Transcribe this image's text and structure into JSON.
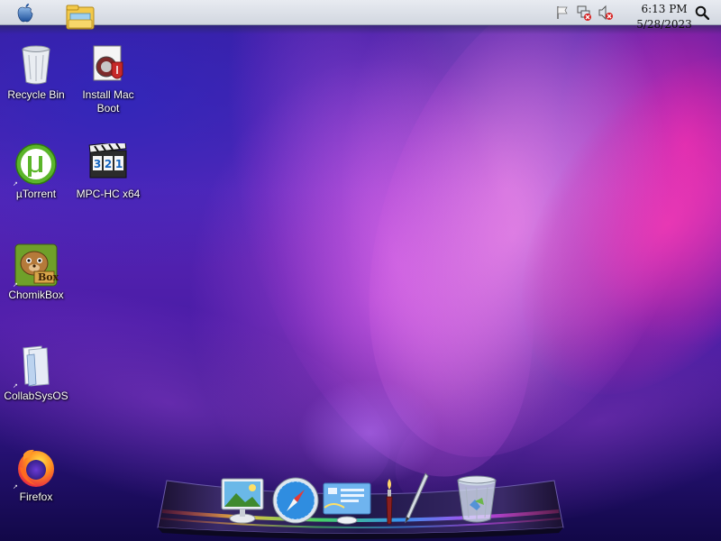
{
  "menubar": {
    "apple_icon": "apple-icon",
    "finder_icon": "file-explorer-icon",
    "tray_icons": [
      "flag-icon",
      "network-error-icon",
      "volume-muted-icon"
    ],
    "clock": {
      "time": "6:13 PM",
      "date": "5/28/2023"
    },
    "search_icon": "search-icon"
  },
  "desktop": {
    "icons": [
      {
        "label": "Recycle Bin",
        "icon": "recycle-bin-icon"
      },
      {
        "label": "Install Mac\nBoot",
        "label_line1": "Install Mac",
        "label_line2": "Boot",
        "icon": "installer-icon"
      },
      {
        "label": "µTorrent",
        "icon": "utorrent-icon"
      },
      {
        "label": "MPC-HC x64",
        "icon": "mpc-hc-icon"
      },
      {
        "label": "ChomikBox",
        "icon": "chomikbox-icon"
      },
      {
        "label": "CollabSysOS",
        "icon": "folder-documents-icon"
      },
      {
        "label": "Firefox",
        "icon": "firefox-icon"
      }
    ]
  },
  "dock": {
    "items": [
      {
        "name": "image-viewer-icon"
      },
      {
        "name": "safari-compass-icon"
      },
      {
        "name": "display-settings-icon"
      },
      {
        "name": "paint-brush-icon"
      },
      {
        "name": "pen-tool-icon"
      },
      {
        "name": "trash-icon"
      }
    ]
  },
  "colors": {
    "menubar_bg": "#dfe3ea",
    "wallpaper_purple": "#5a26b8",
    "wallpaper_pink": "#ff28aa"
  }
}
